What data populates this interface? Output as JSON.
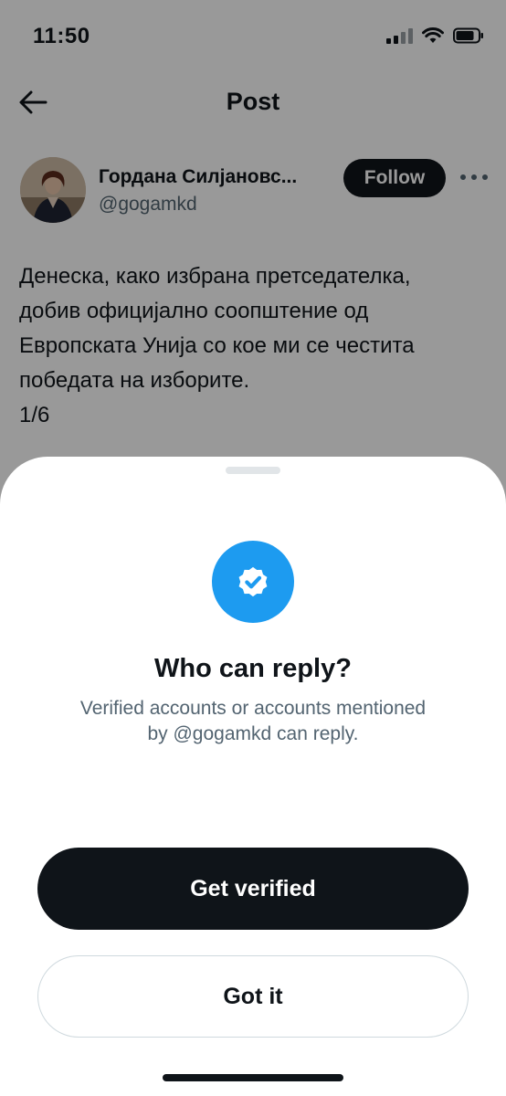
{
  "status_bar": {
    "time": "11:50"
  },
  "header": {
    "title": "Post"
  },
  "post": {
    "author_name": "Гордана Силјановс...",
    "author_handle": "@gogamkd",
    "follow_label": "Follow",
    "text_lines": [
      "Денеска, како избрана претседателка,",
      "добив официјално соопштение од",
      "Европската Унија со кое ми се честита",
      "победата на изборите.",
      "1/6"
    ]
  },
  "sheet": {
    "icon": "verified-badge-icon",
    "title": "Who can reply?",
    "description_lines": [
      "Verified accounts or accounts mentioned",
      "by @gogamkd can reply."
    ],
    "primary_label": "Get verified",
    "secondary_label": "Got it"
  },
  "colors": {
    "accent": "#1d9bf0",
    "text_primary": "#0f1419",
    "text_secondary": "#536471",
    "overlay": "rgba(0,0,0,0.40)"
  }
}
